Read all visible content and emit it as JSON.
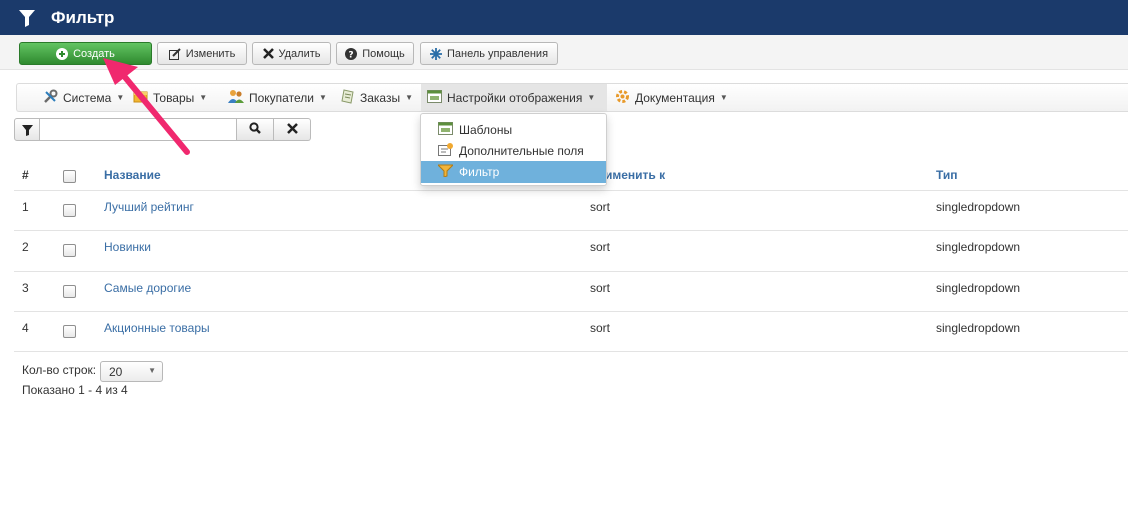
{
  "header": {
    "title": "Фильтр",
    "icon": "funnel-icon"
  },
  "toolbar": {
    "create_label": "Создать",
    "edit_label": "Изменить",
    "delete_label": "Удалить",
    "help_label": "Помощь",
    "control_panel_label": "Панель управления"
  },
  "menu": {
    "items": [
      {
        "label": "Система",
        "icon": "tools-icon"
      },
      {
        "label": "Товары",
        "icon": "products-icon"
      },
      {
        "label": "Покупатели",
        "icon": "users-icon"
      },
      {
        "label": "Заказы",
        "icon": "orders-icon"
      },
      {
        "label": "Настройки отображения",
        "icon": "display-settings-icon"
      },
      {
        "label": "Документация",
        "icon": "documentation-icon"
      }
    ],
    "active_index": 4
  },
  "dropdown": {
    "items": [
      {
        "label": "Шаблоны",
        "icon": "templates-icon"
      },
      {
        "label": "Дополнительные поля",
        "icon": "extra-fields-icon"
      },
      {
        "label": "Фильтр",
        "icon": "filter-icon"
      }
    ],
    "selected_index": 2
  },
  "search": {
    "value": "",
    "placeholder": ""
  },
  "table": {
    "columns": {
      "num": "#",
      "name": "Название",
      "apply_to": "именить к",
      "type": "Тип"
    },
    "rows": [
      {
        "num": "1",
        "name": "Лучший рейтинг",
        "apply_to": "sort",
        "type": "singledropdown"
      },
      {
        "num": "2",
        "name": "Новинки",
        "apply_to": "sort",
        "type": "singledropdown"
      },
      {
        "num": "3",
        "name": "Самые дорогие",
        "apply_to": "sort",
        "type": "singledropdown"
      },
      {
        "num": "4",
        "name": "Акционные товары",
        "apply_to": "sort",
        "type": "singledropdown"
      }
    ]
  },
  "footer": {
    "rows_label": "Кол-во строк:",
    "rows_value": "20",
    "shown_label": "Показано 1 - 4 из 4"
  },
  "colors": {
    "header_bg": "#1b3a6b",
    "primary_green": "#3a9a3a",
    "link_blue": "#3a6ea5",
    "highlight_blue": "#6fb1dc",
    "arrow_pink": "#f0286e"
  }
}
